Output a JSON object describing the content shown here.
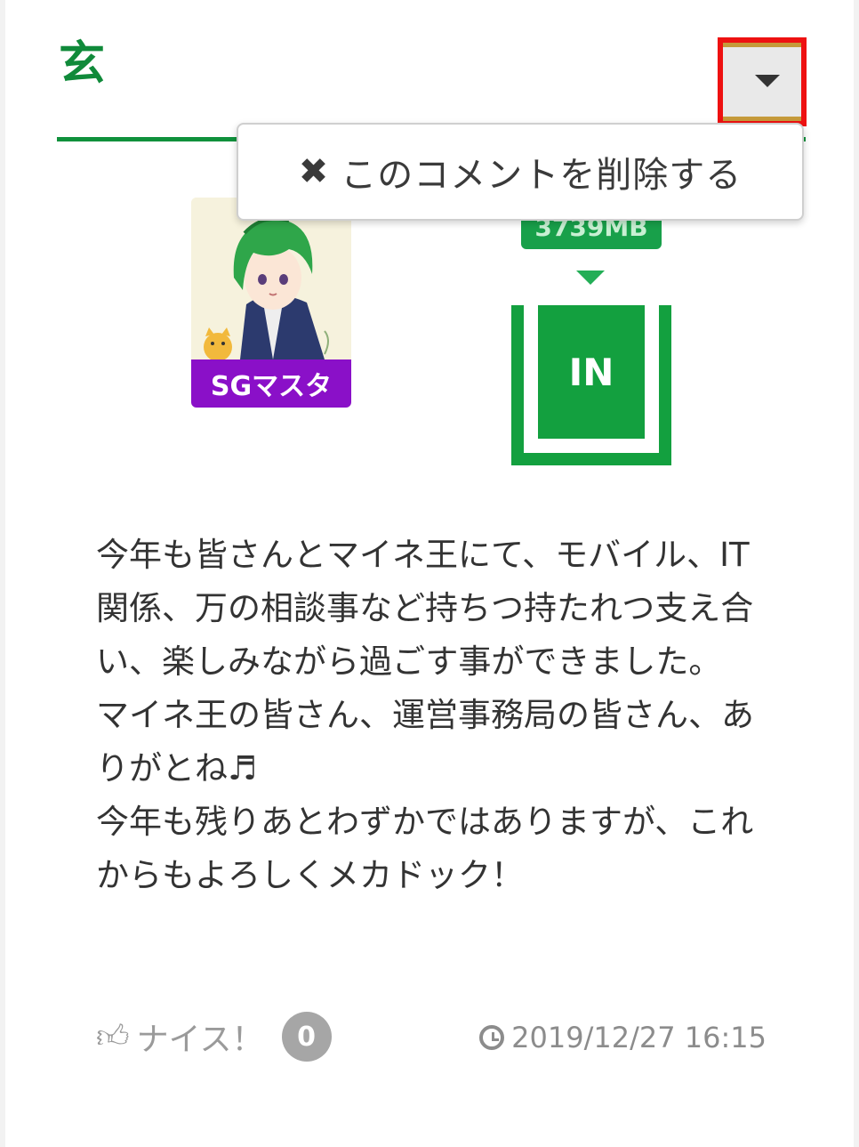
{
  "header": {
    "username": "玄"
  },
  "menu": {
    "delete_icon": "close-icon",
    "delete_label": "このコメントを削除する"
  },
  "user": {
    "badge_label": "SGマスタ"
  },
  "status": {
    "mb_label": "3739MB",
    "in_label": "IN"
  },
  "comment": {
    "paragraphs": [
      "今年も皆さんとマイネ王にて、モバイル、IT関係、万の相談事など持ちつ持たれつ支え合い、楽しみながら過ごす事ができました。",
      "マイネ王の皆さん、運営事務局の皆さん、ありがとね♬",
      "今年も残りあとわずかではありますが、これからもよろしくメカドック！"
    ]
  },
  "footer": {
    "nice_label": "ナイス！",
    "nice_count": "0",
    "timestamp": "2019/12/27 16:15"
  },
  "colors": {
    "brand_green": "#108a3a",
    "badge_purple": "#8a10c8",
    "highlight_red": "#ee1111"
  }
}
